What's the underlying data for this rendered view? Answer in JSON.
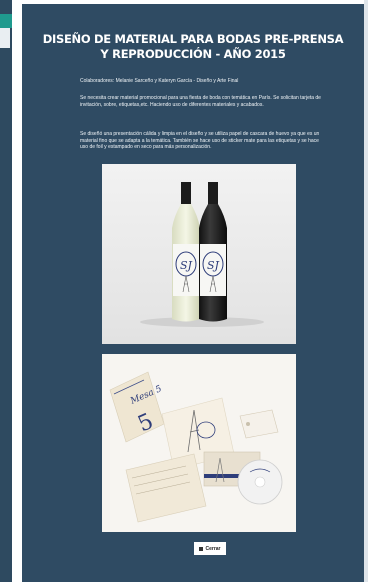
{
  "project": {
    "title_line1": "Diseño de material para bodas pre-prensa",
    "title_line2": "y reproducción - Año 2015",
    "collaborators": "Colaboradores: Melanie Sarceño y Kateryn García - Diseño y Arte Final",
    "description1": "Se necesita crear material promocional para una fiesta de boda con temática en París. Se solicitan tarjeta de invitación, sobre, etiquetas,etc. Haciendo uso de diferentes materiales y acabados.",
    "description2": "Se diseñó una presentación cálida y limpia en el diseño y se utiliza papel de cascara de huevo ya que es un material fino que se adapta a la temática. También se hace uso de sticker mate para las etiquetas y se hace uso de foil y estampado en seco para más personalización."
  },
  "mockup": {
    "monogram": "SJ",
    "table_card": "Mesa 5"
  },
  "close_label": "Cerrar"
}
